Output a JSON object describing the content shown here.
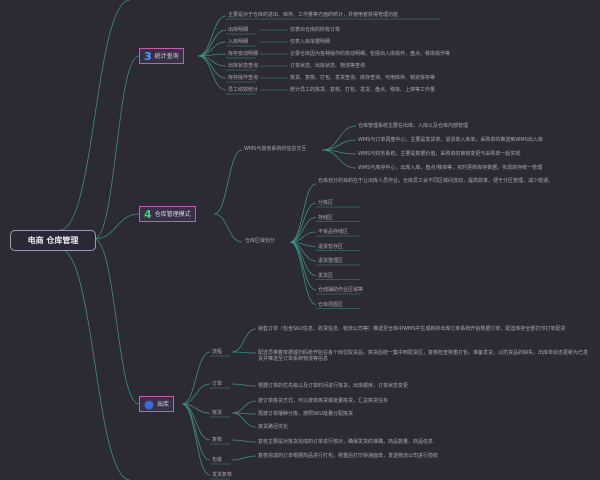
{
  "root": {
    "label": "电商 仓库管理"
  },
  "colors": {
    "background": "#2c2a33",
    "connector": "#3f8f86",
    "branch_border": "#c25fa8",
    "badge_blue": "#4aa0ff",
    "badge_green": "#3fd36a"
  },
  "branch3": {
    "number": "3",
    "label": "统计查询",
    "intro": "主要是对于仓库的进出、库存、工作量等方面的统计，并使用者获得管理功能",
    "items": [
      {
        "name": "出库明细",
        "desc": "仅表出仓库的所有订单"
      },
      {
        "name": "入库明细",
        "desc": "仅表入库单据明细"
      },
      {
        "name": "库存变动明细",
        "desc": "记录仓库因为各种操作的变动明细，包括出入库操作，盘点、移库操作等"
      },
      {
        "name": "出库状态查询",
        "desc": "订单状态、出库状态、物流等查询"
      },
      {
        "name": "库存操作查询",
        "desc": "拣货、复核、打包、发货查询、库存查询、可用库存、锁定库存等"
      },
      {
        "name": "员工绩效统计",
        "desc": "统计员工的拣货、复核、打包、发货、盘点、移库、上架等工作量"
      }
    ]
  },
  "branch4": {
    "number": "4",
    "label": "仓库管理模式",
    "wms": {
      "label": "WMS与其他系统的信息交互",
      "items": [
        "仓库管理系统主要在出库、入库以及仓库内部管理",
        "WMS与订单调度中心，主要是发货单，退货单入库单，采购单的推送到WMS出入库",
        "WMS与财务系统，主要是数据价值，采购单的审核变更与采购单一起实现",
        "WMS与库存中心，出库入库，盘点/移库等，实时更新库存数据，实现库存统一管理"
      ]
    },
    "partition": {
      "label": "仓库区域划分",
      "desc": "仓库划分的目的在于让出库人员作业，仓库员工会不同区域间流动，提高效率，便于分区管理，减少错误。",
      "items": [
        "分拣区",
        "存储区",
        "不良品存储区",
        "退货暂存区",
        "退货整理区",
        "发货区",
        "仓储辅助作业区域等",
        "仓库周围区"
      ]
    }
  },
  "branch5": {
    "number": "5",
    "label": "出库",
    "groups": [
      {
        "name": "流程",
        "items": [
          "销售订单（包含SKU信息、收货信息、物流公司等）推送至仓库中WMS中生成新的出库订单系统开始根据订单，配送库存全部打印打单配货",
          "配送员带着单据或扫码枪开始在各个库位取货品，拣货后统一集中到配货区，复核检查称重打包，准备发货，以防货品的缺失，出库单状态更新为已发货并推送至订单系统物流等信息"
        ]
      },
      {
        "name": "订单",
        "items": [
          "根据订单的优先级以及订单时间进行拣货，出库顺序，订单状态变更"
        ]
      },
      {
        "name": "拣货",
        "items": [
          "按订单拣货方式，可以按单拣货或批量拣货，汇总拣货任务",
          "再按订单播种分拣，按照SKU批量分配拣货",
          "拣货路径优化"
        ]
      },
      {
        "name": "复核",
        "items": [
          "复核主要是对拣货完成的订单进行核对，确保发货的准确，商品数量、商品信息"
        ]
      },
      {
        "name": "包装",
        "items": [
          "复核完成的订单根据商品进行打包，称重后打印快递面单，发送物流公司进行揽收"
        ]
      },
      {
        "name": "发货复核",
        "items": []
      }
    ]
  }
}
